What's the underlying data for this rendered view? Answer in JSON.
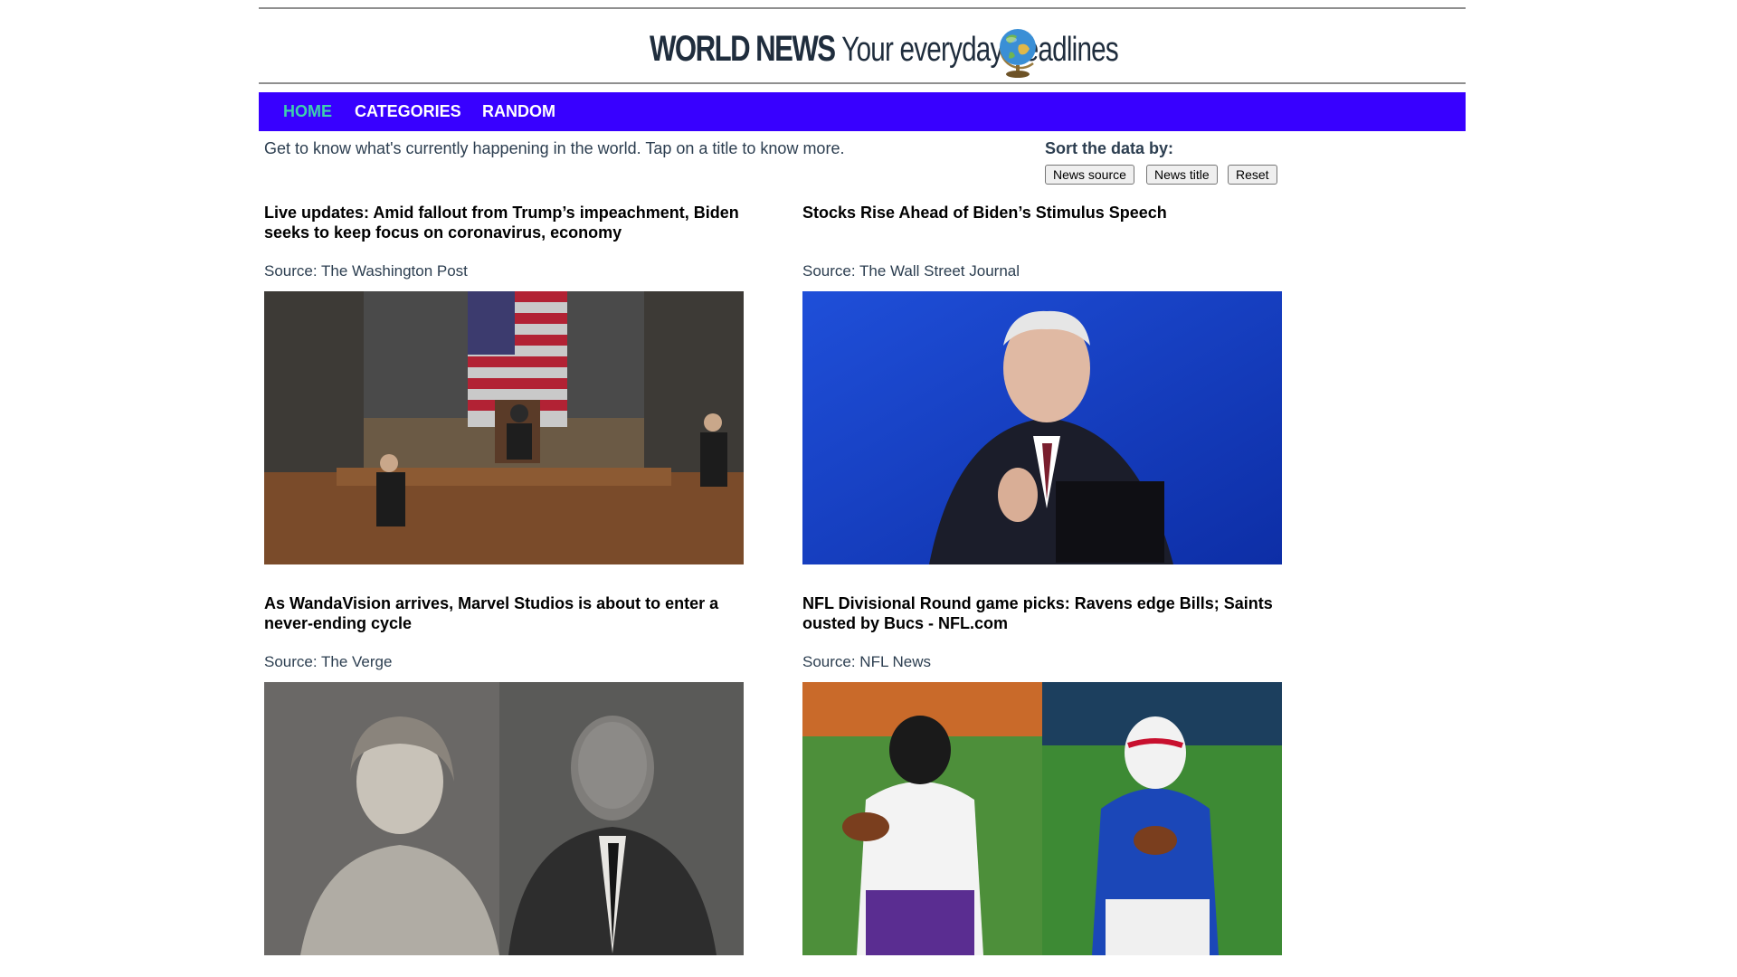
{
  "masthead": {
    "brand": "WORLD NEWS",
    "tagline": "Your everyday headlines",
    "logo_icon": "globe-icon"
  },
  "nav": {
    "items": [
      {
        "label": "HOME",
        "active": true
      },
      {
        "label": "CATEGORIES",
        "active": false
      },
      {
        "label": "RANDOM",
        "active": false
      }
    ],
    "background": "#3800ff",
    "active_color": "#3ecfae"
  },
  "intro": "Get to know what's currently happening in the world. Tap on a title to know more.",
  "sort": {
    "label": "Sort the data by:",
    "buttons": [
      "News source",
      "News title",
      "Reset"
    ]
  },
  "articles": [
    {
      "title": "Live updates: Amid fallout from Trump’s impeachment, Biden seeks to keep focus on coronavirus, economy",
      "source": "Source: The Washington Post"
    },
    {
      "title": "Stocks Rise Ahead of Biden’s Stimulus Speech",
      "source": "Source: The Wall Street Journal"
    },
    {
      "title": "As WandaVision arrives, Marvel Studios is about to enter a never-ending cycle",
      "source": "Source: The Verge"
    },
    {
      "title": "NFL Divisional Round game picks: Ravens edge Bills; Saints ousted by Bucs - NFL.com",
      "source": "Source: NFL News"
    }
  ]
}
